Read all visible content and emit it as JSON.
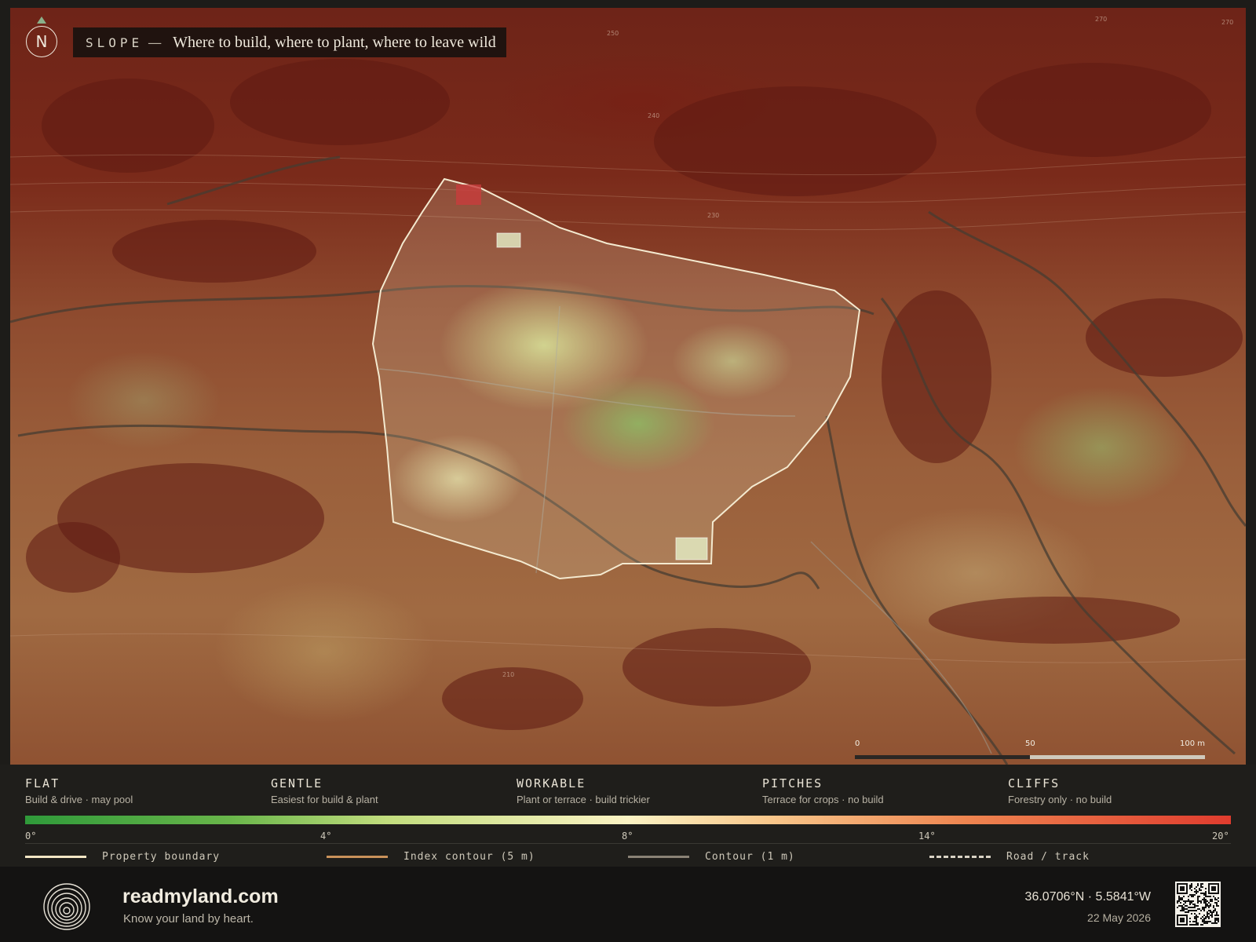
{
  "title": {
    "slope_label": "SLOPE",
    "dash": "—",
    "subtitle": "Where to build, where to plant, where to leave wild"
  },
  "compass": {
    "letter": "N"
  },
  "contour_labels": [
    "250",
    "240",
    "230",
    "270",
    "270",
    "210"
  ],
  "scale_bar": {
    "labels": [
      "0",
      "50",
      "100 m"
    ]
  },
  "categories": [
    {
      "name": "FLAT",
      "desc": "Build & drive · may pool"
    },
    {
      "name": "GENTLE",
      "desc": "Easiest for build & plant"
    },
    {
      "name": "WORKABLE",
      "desc": "Plant or terrace · build trickier"
    },
    {
      "name": "PITCHES",
      "desc": "Terrace for crops · no build"
    },
    {
      "name": "CLIFFS",
      "desc": "Forestry only · no build"
    }
  ],
  "gradient": {
    "ticks": [
      "0°",
      "4°",
      "8°",
      "14°",
      "20°"
    ],
    "colors": [
      "#2f9a3a",
      "#c2dd7e",
      "#fbf3c4",
      "#ee8550",
      "#e03c2e"
    ]
  },
  "keys": [
    {
      "label": "Property boundary",
      "color": "#f2e6c4",
      "style": "solid"
    },
    {
      "label": "Index contour (5 m)",
      "color": "#c9915a",
      "style": "solid"
    },
    {
      "label": "Contour (1 m)",
      "color": "#8a8276",
      "style": "solid"
    },
    {
      "label": "Road / track",
      "color": "#d8d2c4",
      "style": "dashed"
    }
  ],
  "footer": {
    "brand": "readmyland.com",
    "tagline": "Know your land by heart.",
    "coordinates": "36.0706°N · 5.5841°W",
    "date": "22 May 2026"
  }
}
